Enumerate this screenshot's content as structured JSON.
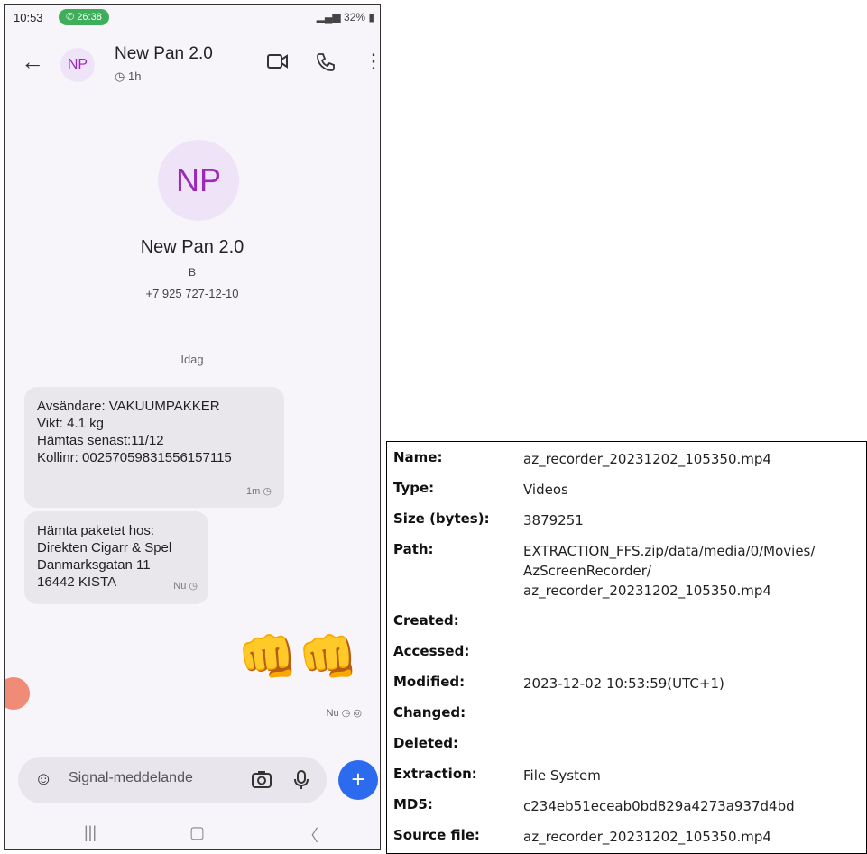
{
  "status_bar": {
    "time": "10:53",
    "call_duration": "26:38",
    "battery": "32%"
  },
  "conversation": {
    "avatar_initials": "NP",
    "name": "New Pan 2.0",
    "disappearing_timer": "1h",
    "profile_sub": "B",
    "phone": "+7 925 727-12-10",
    "date_separator": "Idag"
  },
  "messages": [
    {
      "lines": [
        "Avsändare: VAKUUMPAKKER",
        "Vikt: 4.1 kg",
        "Hämtas senast:11/12",
        "Kollinr: 00257059831556157115"
      ],
      "time": "1m"
    },
    {
      "lines": [
        "Hämta paketet hos:",
        "Direkten Cigarr & Spel",
        "Danmarksgatan 11",
        "16442 KISTA"
      ],
      "time": "Nu"
    }
  ],
  "outgoing": {
    "content": "👊👊",
    "time": "Nu"
  },
  "composer": {
    "placeholder": "Signal-meddelande"
  },
  "icons": {
    "back": "arrow-left",
    "video": "video-camera",
    "call": "phone",
    "menu": "more-vertical",
    "emoji": "smiley",
    "camera": "camera",
    "mic": "microphone",
    "send": "plus",
    "nav_recents": "recents",
    "nav_home": "home",
    "nav_back": "back"
  },
  "properties": {
    "name_label": "Name:",
    "name_value": "az_recorder_20231202_105350.mp4",
    "type_label": "Type:",
    "type_value": "Videos",
    "size_label": "Size (bytes):",
    "size_value": "3879251",
    "path_label": "Path:",
    "path_lines": [
      "EXTRACTION_FFS.zip/data/media/0/Movies/",
      "AzScreenRecorder/",
      "az_recorder_20231202_105350.mp4"
    ],
    "created_label": "Created:",
    "accessed_label": "Accessed:",
    "modified_label": "Modified:",
    "modified_value": "2023-12-02 10:53:59(UTC+1)",
    "changed_label": "Changed:",
    "deleted_label": "Deleted:",
    "extraction_label": "Extraction:",
    "extraction_value": "File System",
    "md5_label": "MD5:",
    "md5_value": "c234eb51eceab0bd829a4273a937d4bd",
    "source_label": "Source file:",
    "source_value": "az_recorder_20231202_105350.mp4"
  }
}
